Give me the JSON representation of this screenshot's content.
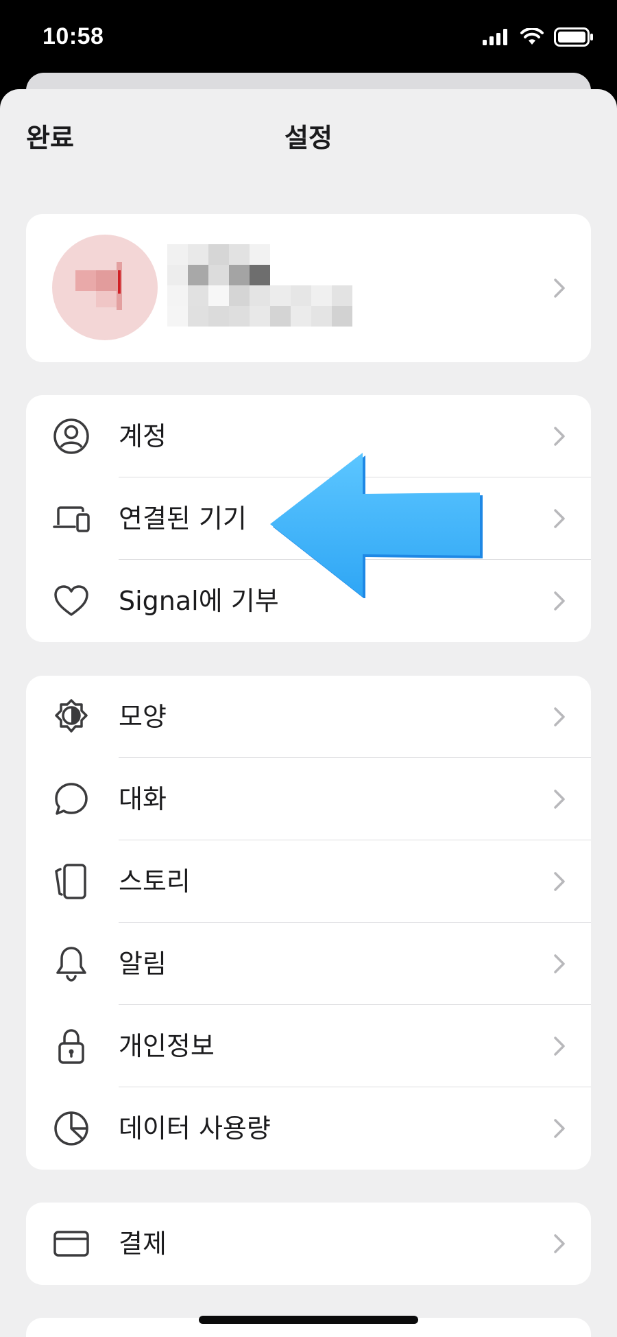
{
  "status_bar": {
    "time": "10:58"
  },
  "nav": {
    "done_label": "완료",
    "title": "설정"
  },
  "groups": [
    {
      "items": [
        {
          "label": "계정",
          "icon": "account-icon"
        },
        {
          "label": "연결된 기기",
          "icon": "linked-devices-icon"
        },
        {
          "label": "Signal에 기부",
          "icon": "heart-icon"
        }
      ]
    },
    {
      "items": [
        {
          "label": "모양",
          "icon": "appearance-icon"
        },
        {
          "label": "대화",
          "icon": "chat-icon"
        },
        {
          "label": "스토리",
          "icon": "stories-icon"
        },
        {
          "label": "알림",
          "icon": "bell-icon"
        },
        {
          "label": "개인정보",
          "icon": "lock-icon"
        },
        {
          "label": "데이터 사용량",
          "icon": "data-usage-icon"
        }
      ]
    },
    {
      "items": [
        {
          "label": "결제",
          "icon": "card-icon"
        }
      ]
    }
  ],
  "colors": {
    "background": "#efeff0",
    "card": "#ffffff",
    "accent_arrow": "#44b8fb"
  }
}
